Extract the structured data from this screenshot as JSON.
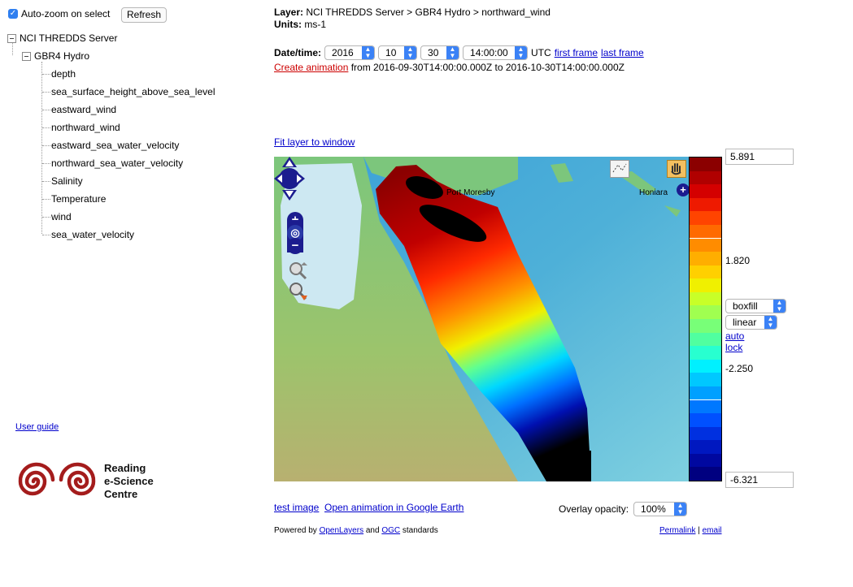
{
  "left_panel": {
    "autozoom_label": "Auto-zoom on select",
    "refresh_label": "Refresh",
    "tree": {
      "root": "NCI THREDDS Server",
      "child": "GBR4 Hydro",
      "leaves": [
        "depth",
        "sea_surface_height_above_sea_level",
        "eastward_wind",
        "northward_wind",
        "eastward_sea_water_velocity",
        "northward_sea_water_velocity",
        "Salinity",
        "Temperature",
        "wind",
        "sea_water_velocity"
      ]
    },
    "user_guide": "User guide",
    "logo_lines": [
      "Reading",
      "e-Science",
      "Centre"
    ]
  },
  "header": {
    "layer_label": "Layer:",
    "layer_value": "NCI THREDDS Server > GBR4 Hydro > northward_wind",
    "units_label": "Units:",
    "units_value": "ms-1",
    "datetime_label": "Date/time:",
    "year": "2016",
    "month": "10",
    "day": "30",
    "time": "14:00:00",
    "utc": "UTC",
    "first_frame": "first frame",
    "last_frame": "last frame",
    "create_animation": "Create animation",
    "anim_range": " from 2016-09-30T14:00:00.000Z to 2016-10-30T14:00:00.000Z",
    "fit_layer": "Fit layer to window"
  },
  "map": {
    "labels": [
      "Port Moresby",
      "Honiara"
    ]
  },
  "scale": {
    "max": "5.891",
    "mid_high": "1.820",
    "mid_low": "-2.250",
    "min": "-6.321",
    "style": "boxfill",
    "scaling": "linear",
    "auto": "auto",
    "lock": "lock",
    "colors": [
      "#8b0000",
      "#b00000",
      "#d40000",
      "#ee1a00",
      "#ff4400",
      "#ff6a00",
      "#ff8c00",
      "#ffae00",
      "#ffd000",
      "#f0f000",
      "#c8ff28",
      "#a0ff50",
      "#78ff78",
      "#50ffa0",
      "#28ffd0",
      "#00f0ff",
      "#00c8ff",
      "#00a0ff",
      "#0078ff",
      "#0050ff",
      "#0030e0",
      "#0018c0",
      "#0008a0",
      "#000080"
    ]
  },
  "bottom": {
    "test_image": "test image",
    "google_earth": "Open animation in Google Earth",
    "opacity_label": "Overlay opacity:",
    "opacity_value": "100%",
    "powered_prefix": "Powered by ",
    "openlayers": "OpenLayers",
    "and": " and ",
    "ogc": "OGC",
    "standards": " standards",
    "permalink": "Permalink",
    "sep": " | ",
    "email": "email"
  }
}
